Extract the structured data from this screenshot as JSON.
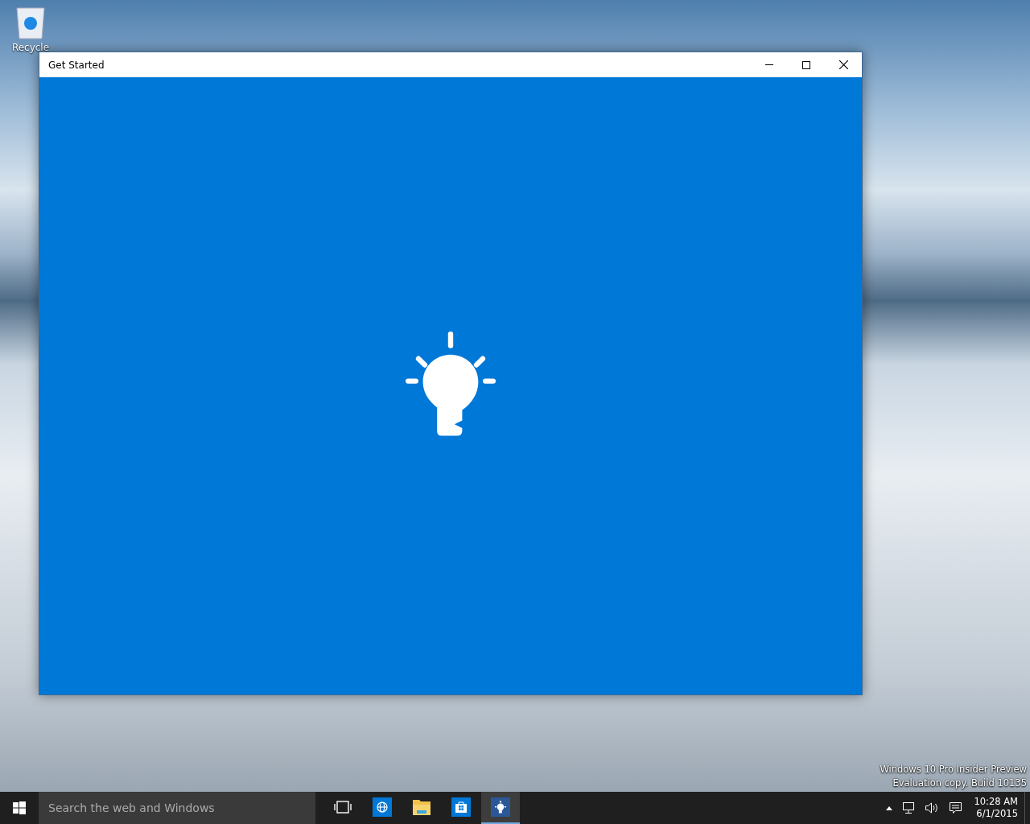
{
  "desktop": {
    "icons": [
      {
        "label": "Recycle"
      }
    ],
    "watermark": [
      "Windows 10 Pro Insider Preview",
      "Evaluation copy. Build 10135"
    ]
  },
  "window": {
    "title": "Get Started"
  },
  "taskbar": {
    "search": {
      "placeholder": "Search the web and Windows"
    },
    "apps": [
      {
        "kind": "taskview",
        "selected": false
      },
      {
        "kind": "browser",
        "selected": false
      },
      {
        "kind": "explorer",
        "selected": false
      },
      {
        "kind": "store",
        "selected": false
      },
      {
        "kind": "tips",
        "selected": true
      }
    ],
    "clock": {
      "time": "10:28 AM",
      "date": "6/1/2015"
    }
  }
}
